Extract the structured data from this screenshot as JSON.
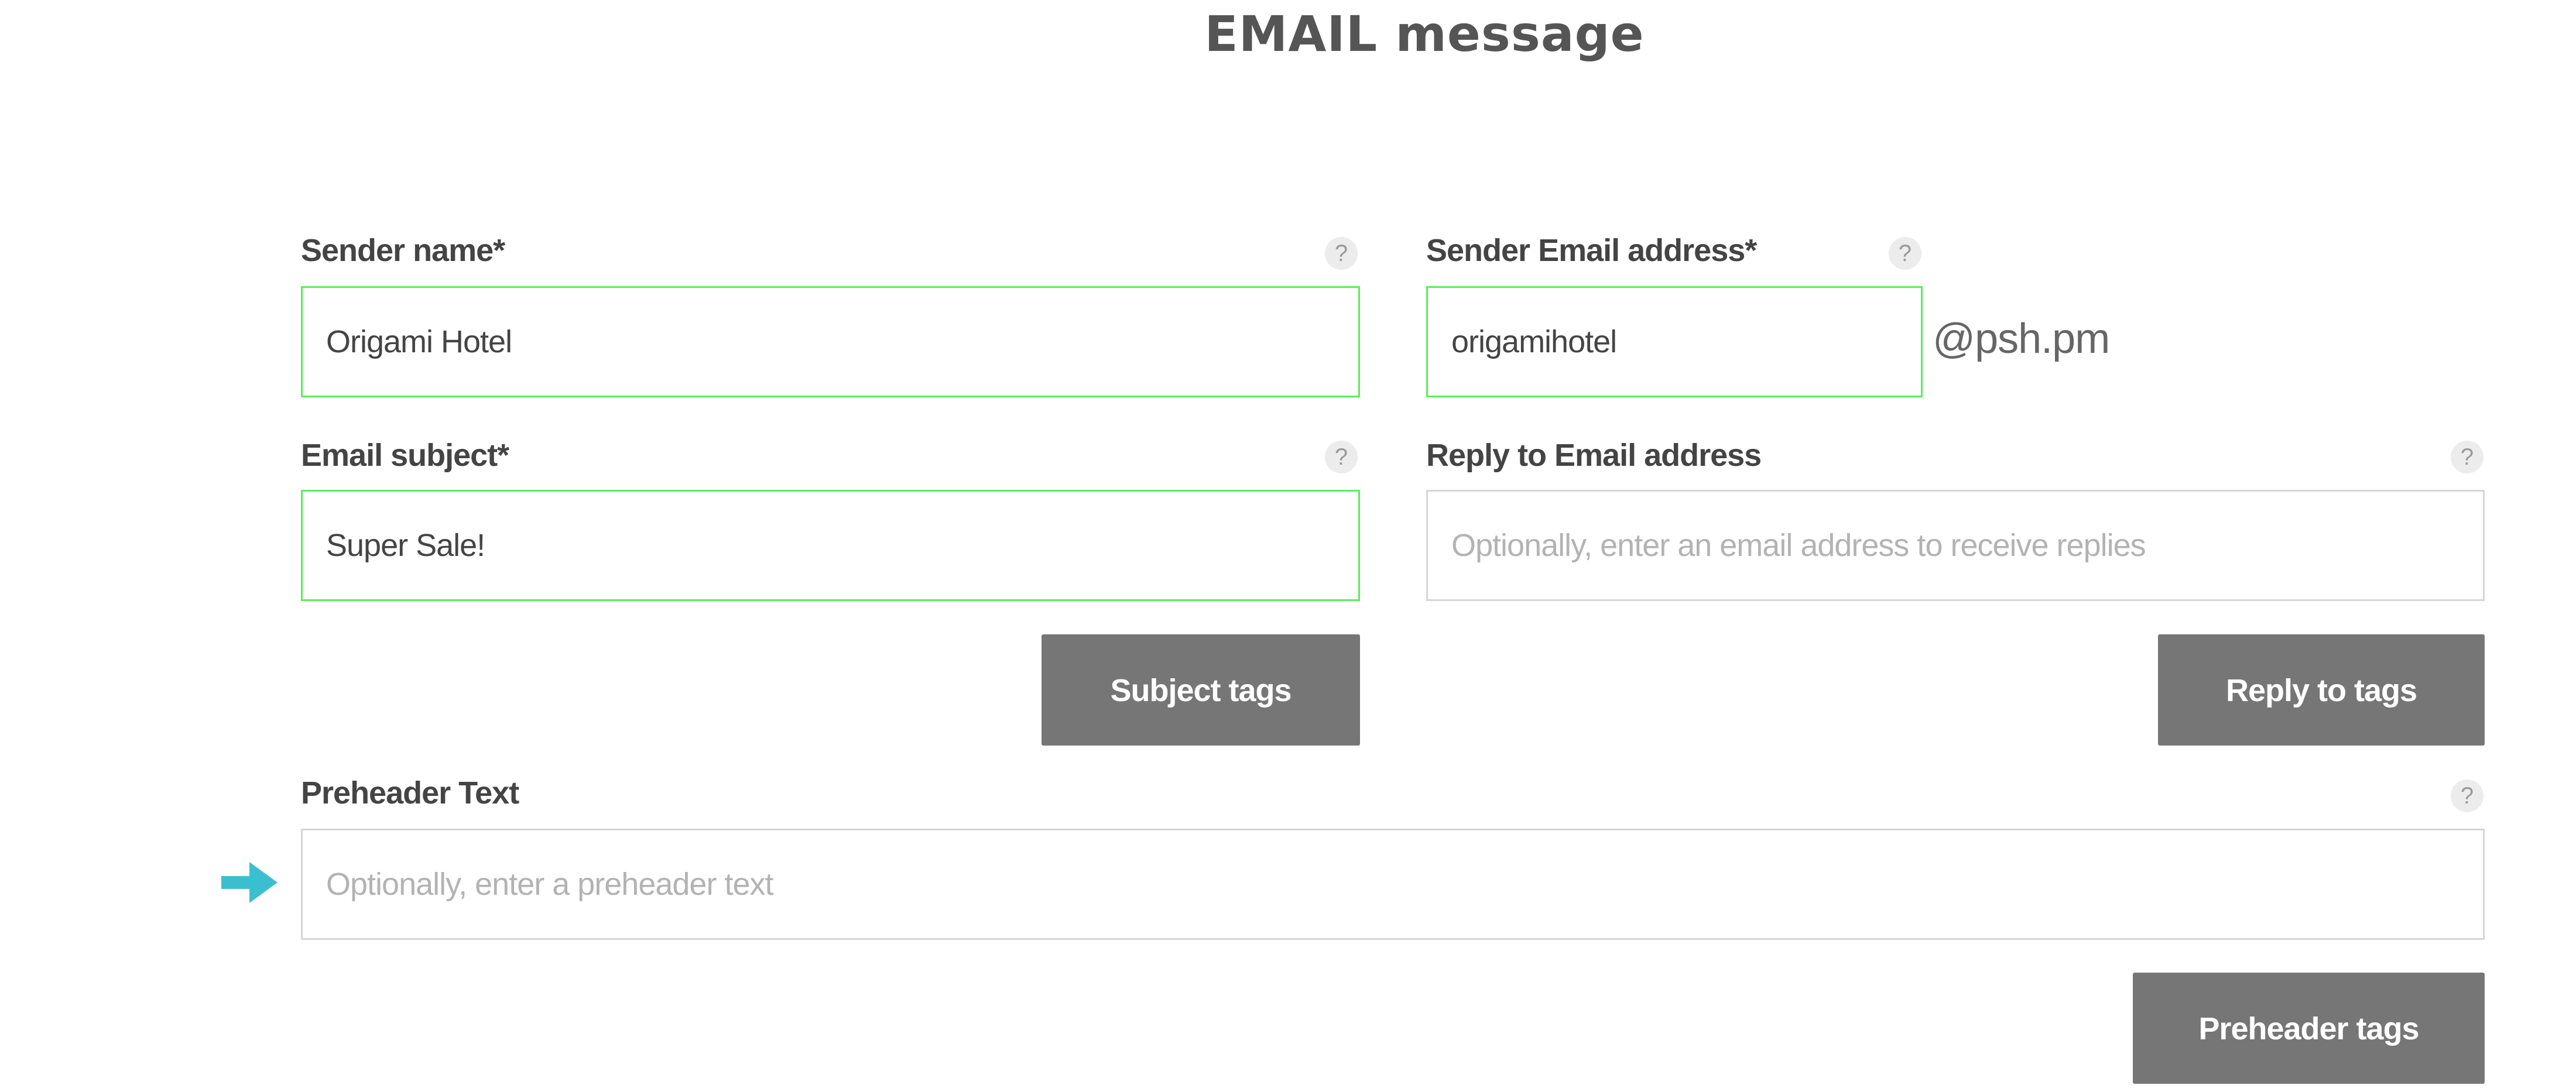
{
  "page": {
    "title": "EMAIL message"
  },
  "sender_name": {
    "label": "Sender name*",
    "value": "Origami Hotel",
    "help_glyph": "?"
  },
  "sender_email": {
    "label": "Sender Email address*",
    "value": "origamihotel",
    "domain_suffix": "@psh.pm",
    "help_glyph": "?"
  },
  "email_subject": {
    "label": "Email subject*",
    "value": "Super Sale!",
    "help_glyph": "?"
  },
  "reply_to": {
    "label": "Reply to Email address",
    "value": "",
    "placeholder": "Optionally, enter an email address to receive replies",
    "help_glyph": "?"
  },
  "buttons": {
    "subject_tags": "Subject tags",
    "reply_to_tags": "Reply to tags",
    "preheader_tags": "Preheader tags"
  },
  "preheader": {
    "label": "Preheader Text",
    "value": "",
    "placeholder": "Optionally, enter a preheader text",
    "help_glyph": "?"
  },
  "colors": {
    "valid_border": "#5aee5a",
    "button_background": "#767676",
    "pointer_arrow": "#3bbfd0"
  },
  "icons": {
    "help": "question-mark-circle",
    "pointer": "right-arrow"
  }
}
